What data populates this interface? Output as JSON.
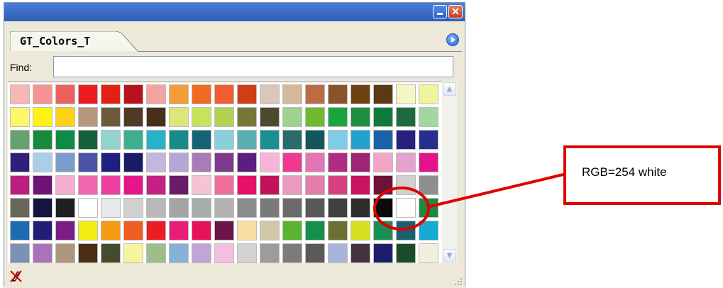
{
  "window": {
    "tab_label": "GT_Colors_T",
    "find_label": "Find:",
    "find_value": "",
    "minimize_icon": "minimize-icon",
    "close_icon": "close-icon",
    "close_glyph": "×",
    "panel_menu_icon": "panel-menu-icon",
    "scroll_up_icon": "scroll-up-icon",
    "scroll_down_icon": "scroll-down-icon",
    "no_edit_icon": "pencil-disabled-icon",
    "resize_grip_icon": "resize-grip-icon"
  },
  "swatches": [
    [
      "#f9b6b6",
      "#f59393",
      "#ef5f5f",
      "#ee1c1c",
      "#e42014",
      "#b8121c",
      "#f4a3a0",
      "#f59c37",
      "#f26922",
      "#f25c32",
      "#d13d15",
      "#d9c8b8",
      "#d3b89a",
      "#bb6c45",
      "#8b5329",
      "#6d4212",
      "#5a3914",
      "#f5f6c6",
      "#eff59a"
    ],
    [
      "#fdf76a",
      "#fff212",
      "#ffd217",
      "#b5987b",
      "#6d5a3a",
      "#4f3a26",
      "#46301a",
      "#dce77a",
      "#c7e25b",
      "#b2d24f",
      "#777739",
      "#4d4b2f",
      "#9ed28d",
      "#6dbb2c",
      "#18a43e",
      "#208e3f",
      "#0f7a3c",
      "#1c6b40",
      "#a3d7a0"
    ],
    [
      "#64a36e",
      "#198a3c",
      "#0c8c46",
      "#14603a",
      "#91d3ce",
      "#3eae8f",
      "#26b2c9",
      "#178a8a",
      "#146474",
      "#87d0dc",
      "#5aafb1",
      "#1a8e90",
      "#296c69",
      "#13575a",
      "#7dcde8",
      "#22a3cd",
      "#1b63a5",
      "#2a1e80",
      "#262e8e"
    ],
    [
      "#2f1f7a",
      "#a9cfe8",
      "#7b9ccd",
      "#4a53a6",
      "#1f1f80",
      "#1a1a66",
      "#c4b7dc",
      "#b7a6d5",
      "#ab7ab8",
      "#7b3c8e",
      "#5c1e7f",
      "#f7b4d8",
      "#ef3a92",
      "#e375b7",
      "#b22b83",
      "#9c2576",
      "#f2a5c5",
      "#e3a3cc",
      "#e6128c"
    ],
    [
      "#bd1d80",
      "#6f1477",
      "#f7aed3",
      "#f166ad",
      "#ef3ea2",
      "#e7158a",
      "#c42086",
      "#6b1c68",
      "#f6c3d6",
      "#ee6f9c",
      "#e6106b",
      "#c4125a",
      "#e99ac0",
      "#e27eab",
      "#d5427f",
      "#c6145f",
      "#6e1338",
      "#d1d1d1",
      "#8e8e8e"
    ],
    [
      "#6a6658",
      "#16143e",
      "#1f1f1f",
      "#ffffff",
      "#e9e9e9",
      "#d1d1d1",
      "#b8b8b8",
      "#a4a4a4",
      "#a5adad",
      "#b2b2b2",
      "#8c8c8c",
      "#7a7a7a",
      "#6b6b6b",
      "#585858",
      "#404040",
      "#2d2d2d",
      "#0a0a0a",
      "#fefefe",
      "#1c8a3e"
    ],
    [
      "#1e6bb2",
      "#1f1f78",
      "#7a1e84",
      "#f2ee14",
      "#f59a12",
      "#f15c22",
      "#ec1c24",
      "#ea1c7a",
      "#e6115b",
      "#6a1448",
      "#f9dea1",
      "#d4c8ab",
      "#5cb331",
      "#15904c",
      "#6b7133",
      "#d5e11c",
      "#1b8e56",
      "#176070",
      "#16aad0"
    ],
    [
      "#7992b6",
      "#aa72b9",
      "#ad967c",
      "#4a2e14",
      "#454c2e",
      "#f6f4a0",
      "#9dbe8a",
      "#87b2d8",
      "#c1a5d8",
      "#f5bde0",
      "#d2d2d2",
      "#9c9c9c",
      "#7b7b7b",
      "#595959",
      "#a8b4dc",
      "#44323f",
      "#1d1d6e",
      "#1a4c2a",
      "#f0efe0"
    ]
  ],
  "annotation": {
    "label": "RGB=254 white"
  },
  "colors": {
    "annotation_red": "#e00000",
    "title_blue": "#3b6cc8",
    "panel_bg": "#ece9d8"
  }
}
